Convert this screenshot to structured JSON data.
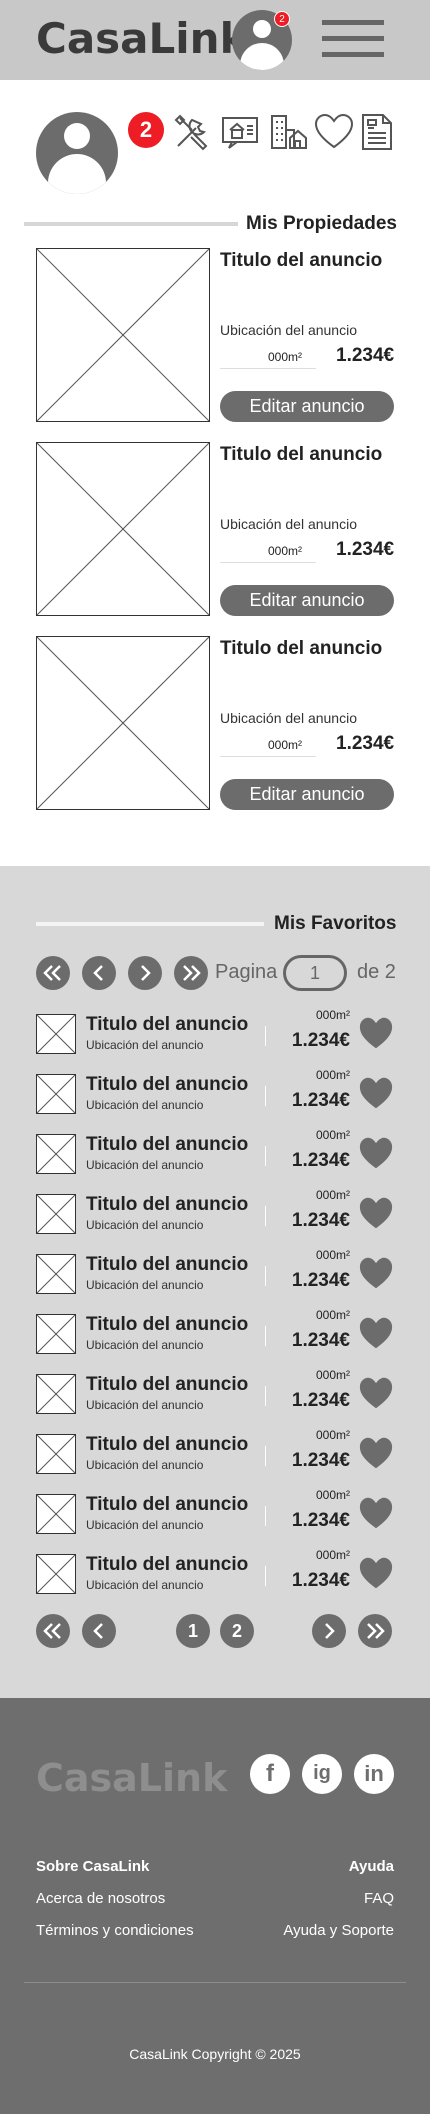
{
  "header": {
    "logo": "CasaLink",
    "notification_count": "2",
    "menu_icon": "hamburger-menu-icon"
  },
  "profile": {
    "notification_count": "2",
    "icons": [
      "tools-icon",
      "house-listing-icon",
      "buildings-icon",
      "heart-icon",
      "document-icon"
    ]
  },
  "properties": {
    "title": "Mis Propiedades",
    "items": [
      {
        "title": "Titulo del anuncio",
        "location": "Ubicación del anuncio",
        "area": "000m²",
        "price": "1.234€",
        "button": "Editar anuncio"
      },
      {
        "title": "Titulo del anuncio",
        "location": "Ubicación del anuncio",
        "area": "000m²",
        "price": "1.234€",
        "button": "Editar anuncio"
      },
      {
        "title": "Titulo del anuncio",
        "location": "Ubicación del anuncio",
        "area": "000m²",
        "price": "1.234€",
        "button": "Editar anuncio"
      }
    ]
  },
  "favorites": {
    "title": "Mis Favoritos",
    "pagination_top": {
      "page_label": "Pagina",
      "current_page": "1",
      "total_label": "de 2"
    },
    "pagination_bottom": {
      "pages": [
        "1",
        "2"
      ]
    },
    "items": [
      {
        "title": "Titulo del anuncio",
        "location": "Ubicación del anuncio",
        "area": "000m²",
        "price": "1.234€"
      },
      {
        "title": "Titulo del anuncio",
        "location": "Ubicación del anuncio",
        "area": "000m²",
        "price": "1.234€"
      },
      {
        "title": "Titulo del anuncio",
        "location": "Ubicación del anuncio",
        "area": "000m²",
        "price": "1.234€"
      },
      {
        "title": "Titulo del anuncio",
        "location": "Ubicación del anuncio",
        "area": "000m²",
        "price": "1.234€"
      },
      {
        "title": "Titulo del anuncio",
        "location": "Ubicación del anuncio",
        "area": "000m²",
        "price": "1.234€"
      },
      {
        "title": "Titulo del anuncio",
        "location": "Ubicación del anuncio",
        "area": "000m²",
        "price": "1.234€"
      },
      {
        "title": "Titulo del anuncio",
        "location": "Ubicación del anuncio",
        "area": "000m²",
        "price": "1.234€"
      },
      {
        "title": "Titulo del anuncio",
        "location": "Ubicación del anuncio",
        "area": "000m²",
        "price": "1.234€"
      },
      {
        "title": "Titulo del anuncio",
        "location": "Ubicación del anuncio",
        "area": "000m²",
        "price": "1.234€"
      },
      {
        "title": "Titulo del anuncio",
        "location": "Ubicación del anuncio",
        "area": "000m²",
        "price": "1.234€"
      }
    ]
  },
  "footer": {
    "logo": "CasaLink",
    "social": [
      "f",
      "ig",
      "in"
    ],
    "left_heading": "Sobre CasaLink",
    "left_links": [
      "Acerca de nosotros",
      "Términos y condiciones"
    ],
    "right_heading": "Ayuda",
    "right_links": [
      "FAQ",
      "Ayuda y Soporte"
    ],
    "copyright": "CasaLink Copyright © 2025"
  },
  "colors": {
    "header_bg": "#c8c8c8",
    "accent_gray": "#6c6c6c",
    "badge_red": "#ee1c24",
    "favorites_bg": "#d8d8d8",
    "footer_bg": "#6e6e6e"
  }
}
